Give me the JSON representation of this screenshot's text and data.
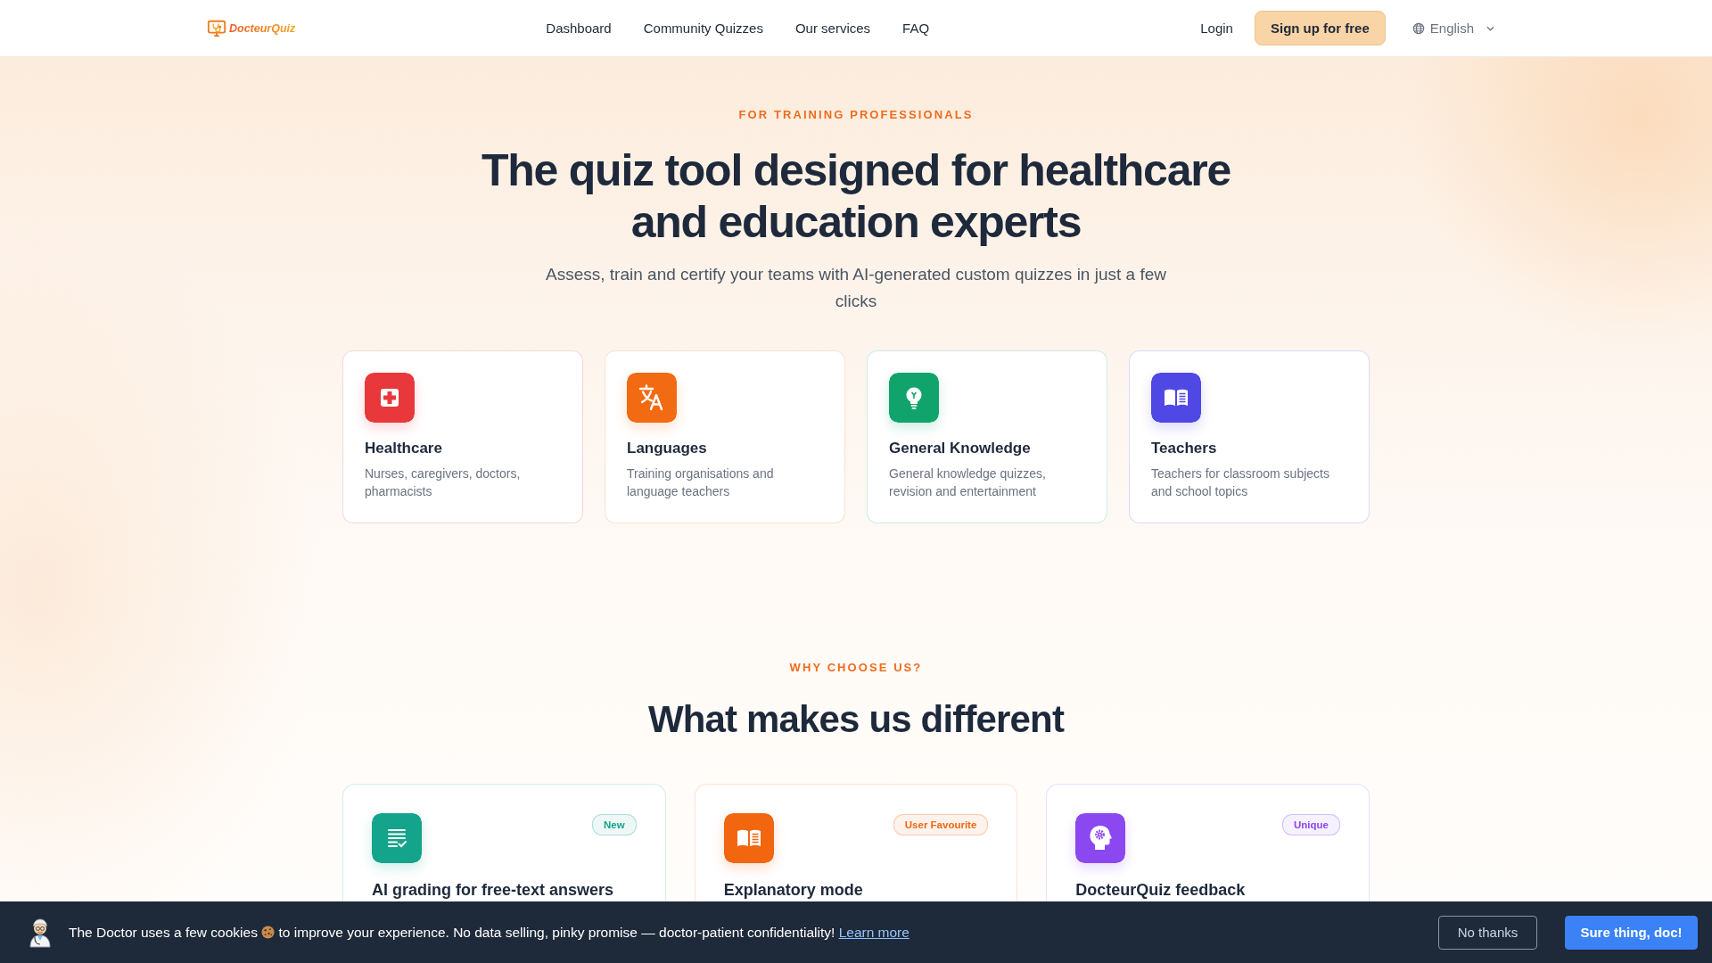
{
  "header": {
    "logo": "DocteurQuiz",
    "nav": [
      {
        "label": "Dashboard"
      },
      {
        "label": "Community Quizzes"
      },
      {
        "label": "Our services"
      },
      {
        "label": "FAQ"
      }
    ],
    "login": "Login",
    "signup": "Sign up for free",
    "language": "English"
  },
  "hero": {
    "eyebrow": "FOR TRAINING PROFESSIONALS",
    "title": "The quiz tool designed for healthcare and education experts",
    "subtitle": "Assess, train and certify your teams with AI-generated custom quizzes in just a few clicks",
    "audiences": [
      {
        "title": "Healthcare",
        "description": "Nurses, caregivers, doctors, pharmacists",
        "color": "#e8383b"
      },
      {
        "title": "Languages",
        "description": "Training organisations and language teachers",
        "color": "#f26a12"
      },
      {
        "title": "General Knowledge",
        "description": "General knowledge quizzes, revision and entertainment",
        "color": "#10a46c"
      },
      {
        "title": "Teachers",
        "description": "Teachers for classroom subjects and school topics",
        "color": "#5048e5"
      }
    ]
  },
  "features": {
    "eyebrow": "WHY CHOOSE US?",
    "title": "What makes us different",
    "cards": [
      {
        "badge": "New",
        "title": "AI grading for free-text answers",
        "color": "#14a38b"
      },
      {
        "badge": "User Favourite",
        "title": "Explanatory mode",
        "color": "#f2660f"
      },
      {
        "badge": "Unique",
        "title": "DocteurQuiz feedback",
        "color": "#8b47f0"
      }
    ]
  },
  "cookie_banner": {
    "message_parts": [
      "The Doctor uses a few cookies",
      "to improve your experience. No data selling, pinky promise — doctor-patient confidentiality!"
    ],
    "link": "Learn more",
    "buttons": [
      {
        "kind": "secondary",
        "label": "No thanks"
      },
      {
        "kind": "primary",
        "label": "Sure thing, doc!"
      }
    ]
  }
}
